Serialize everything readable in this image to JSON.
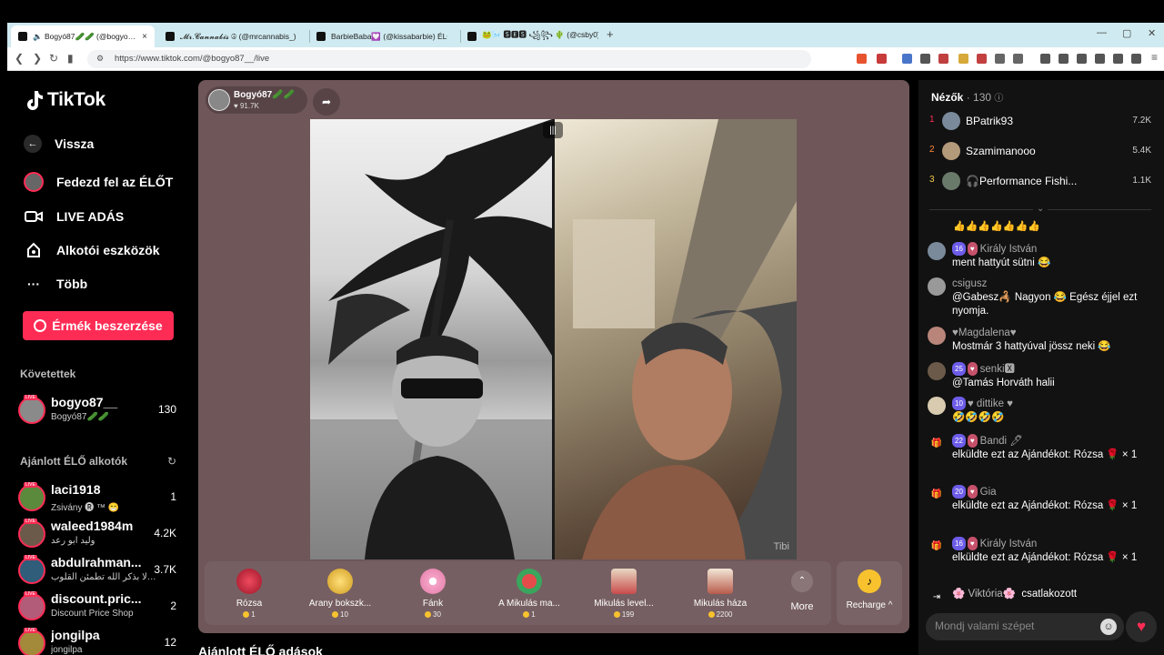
{
  "browser": {
    "tabs": [
      {
        "label": "🔈 Bogyó87🥒🥒 (@bogyo87_",
        "active": true
      },
      {
        "label": "𝓜𝓻.𝓒𝓪𝓷𝓷𝓪𝓫𝓲𝓼 ☮ (@mrcannabis_)"
      },
      {
        "label": "BarbieBaba💟 (@kissabarbie) ÉLŐ a"
      },
      {
        "label": "🐸🌬️ 🆂🅴🆂 ꧁꧂ 🌵 (@csby0)"
      }
    ],
    "close_glyph": "×",
    "new_tab_glyph": "+",
    "url": "https://www.tiktok.com/@bogyo87__/live"
  },
  "sidebar": {
    "logo_text": "TikTok",
    "back_label": "Vissza",
    "nav": [
      {
        "label": "Fedezd fel az ÉLŐT",
        "icon": "avatar-icon"
      },
      {
        "label": "LIVE ADÁS",
        "icon": "camera-icon"
      },
      {
        "label": "Alkotói eszközök",
        "icon": "creator-tools-icon"
      },
      {
        "label": "Több",
        "icon": "more-icon"
      }
    ],
    "buy_coins_label": "Érmék beszerzése",
    "following_title": "Követettek",
    "following": [
      {
        "name": "bogyo87__",
        "sub": "Bogyó87🥒🥒",
        "count": "130"
      }
    ],
    "recommended_title": "Ajánlott ÉLŐ alkotók",
    "recommended": [
      {
        "name": "laci1918",
        "sub": "Zsivány 🅡 ™ 😁",
        "count": "1"
      },
      {
        "name": "waleed1984m",
        "sub": "وليد ابو رعد",
        "count": "4.2K"
      },
      {
        "name": "abdulrahman...",
        "sub": "ألا بذكر الله تطمئن القلوب ...",
        "count": "3.7K"
      },
      {
        "name": "discount.pric...",
        "sub": "Discount Price Shop",
        "count": "2"
      },
      {
        "name": "jongilpa",
        "sub": "jongilpa",
        "count": "12"
      }
    ],
    "live_tag": "LIVE"
  },
  "stream": {
    "host_name": "Bogyó87🥒🥒",
    "host_likes": "♥ 91.7K",
    "watermark": "Tibi",
    "gifts": [
      {
        "name": "Rózsa",
        "price": "1",
        "color": "#d92b45"
      },
      {
        "name": "Arany bokszk...",
        "price": "10",
        "color": "#f2c94c"
      },
      {
        "name": "Fánk",
        "price": "30",
        "color": "#f5a3c7"
      },
      {
        "name": "A Mikulás ma...",
        "price": "1",
        "color": "#3aa55d"
      },
      {
        "name": "Mikulás level...",
        "price": "199",
        "color": "#c94b4b"
      },
      {
        "name": "Mikulás háza",
        "price": "2200",
        "color": "#b85c4c"
      }
    ],
    "more_label": "More",
    "recharge_label": "Recharge ^"
  },
  "bottom_heading": "Ajánlott ÉLŐ adások",
  "viewers": {
    "title": "Nézők",
    "count": "· 130",
    "list": [
      {
        "rank": "1",
        "name": "BPatrik93",
        "score": "7.2K"
      },
      {
        "rank": "2",
        "name": "Szamimanooo",
        "score": "5.4K"
      },
      {
        "rank": "3",
        "name": "🎧Performance Fishi...",
        "score": "1.1K"
      }
    ]
  },
  "chat": {
    "emoji_row": "👍👍👍👍👍👍👍",
    "messages": [
      {
        "badge": "16",
        "badge2": "♥",
        "user": "Király István",
        "text": "ment hattyút sütni 😂"
      },
      {
        "badge": "",
        "badge2": "",
        "user": "csigusz",
        "text": "@Gabesz🦂 Nagyon 😂 Egész éjjel ezt nyomja."
      },
      {
        "badge": "",
        "badge2": "",
        "user": "♥Magdalena♥",
        "text": "Mostmár 3 hattyúval jössz neki 😂"
      },
      {
        "badge": "25",
        "badge2": "♥",
        "user": "senki🆇",
        "text": "@Tamás Horváth halii"
      },
      {
        "badge": "10",
        "badge2": "",
        "user": "♥ dittike ♥",
        "text": "🤣🤣🤣🤣"
      },
      {
        "badge": "22",
        "badge2": "♥",
        "user": "Bandi 🖊",
        "text": "elküldte ezt az Ajándékot: Rózsa 🌹 × 1"
      },
      {
        "badge": "20",
        "badge2": "♥",
        "user": "Gia",
        "text": "elküldte ezt az Ajándékot: Rózsa 🌹 × 1"
      },
      {
        "badge": "16",
        "badge2": "♥",
        "user": "Király István",
        "text": "elküldte ezt az Ajándékot: Rózsa 🌹 × 1"
      }
    ],
    "join_user": "🌸 Viktória🌸",
    "join_text": "csatlakozott",
    "input_placeholder": "Mondj valami szépet"
  }
}
